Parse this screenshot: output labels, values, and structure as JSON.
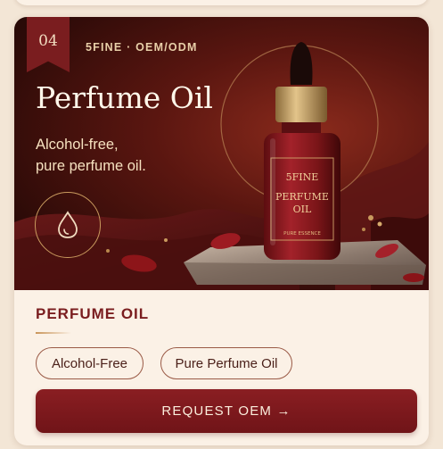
{
  "card": {
    "number": "04",
    "brand_line": "5FINE · OEM/ODM",
    "hero_title": "Perfume Oil",
    "hero_subtitle_line1": "Alcohol-free,",
    "hero_subtitle_line2": "pure perfume oil.",
    "bottle_brand": "5FINE",
    "bottle_name_line1": "PERFUME",
    "bottle_name_line2": "OIL",
    "bottle_footer": "PURE ESSENCE",
    "section_title": "PERFUME OIL",
    "tags": [
      "Alcohol-Free",
      "Pure Perfume Oil"
    ],
    "cta_label": "REQUEST OEM →"
  },
  "colors": {
    "accent": "#7a1d1f",
    "gold": "#c99a5e",
    "card_bg": "#fbf1e6",
    "page_bg": "#f3e6d6"
  },
  "icons": [
    "drop-icon"
  ]
}
